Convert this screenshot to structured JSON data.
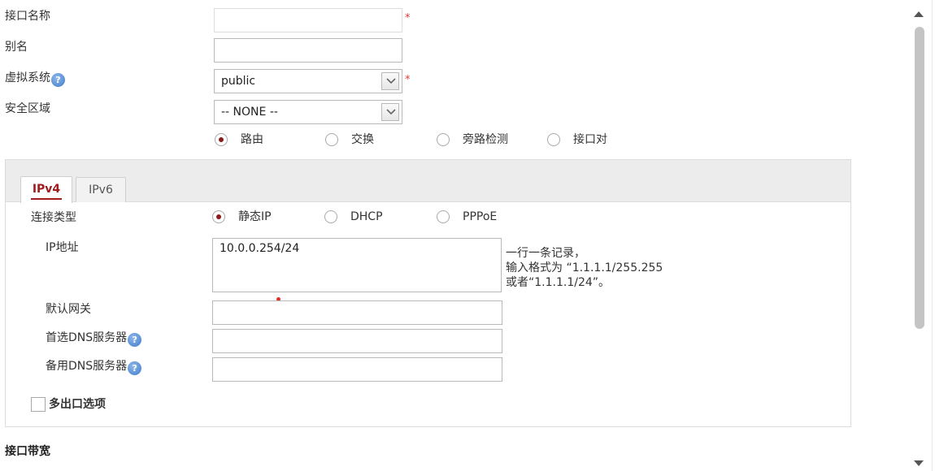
{
  "form": {
    "interface_name_label": "接口名称",
    "alias_label": "别名",
    "vsys_label": "虚拟系统",
    "vsys_value": "public",
    "zone_label": "安全区域",
    "zone_value": "-- NONE --",
    "required_mark": "*",
    "help_glyph": "?"
  },
  "mode": {
    "options": [
      "路由",
      "交换",
      "旁路检测",
      "接口对"
    ],
    "selected": "路由"
  },
  "tabs": [
    {
      "label": "IPv4",
      "active": true
    },
    {
      "label": "IPv6",
      "active": false
    }
  ],
  "ipv4": {
    "connection_type_label": "连接类型",
    "connection_options": [
      "静态IP",
      "DHCP",
      "PPPoE"
    ],
    "selected": "静态IP",
    "ip_label": "IP地址",
    "ip_value": "10.0.0.254/24",
    "ip_hint_line1": "一行一条记录，",
    "ip_hint_line2": "输入格式为 “1.1.1.1/255.255",
    "ip_hint_line3": "或者“1.1.1.1/24”。",
    "gateway_label": "默认网关",
    "dns1_label": "首选DNS服务器",
    "dns2_label": "备用DNS服务器",
    "multi_exit_label": "多出口选项"
  },
  "section": {
    "bandwidth_title": "接口带宽"
  },
  "colors": {
    "accent": "#a01c1c",
    "required": "#e03a3a",
    "help_icon": "#3f7cc9"
  }
}
